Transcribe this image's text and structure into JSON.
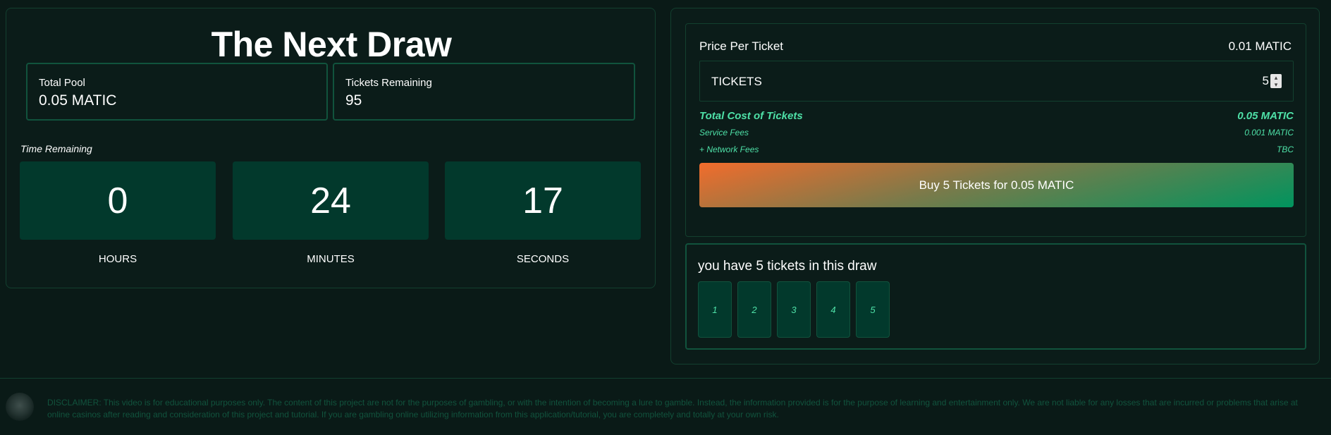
{
  "draw": {
    "title": "The Next Draw",
    "total_pool_label": "Total Pool",
    "total_pool_value": "0.05 MATIC",
    "tickets_remaining_label": "Tickets Remaining",
    "tickets_remaining_value": "95",
    "time_remaining_label": "Time Remaining",
    "hours_value": "0",
    "hours_label": "HOURS",
    "minutes_value": "24",
    "minutes_label": "MINUTES",
    "seconds_value": "17",
    "seconds_label": "SECONDS"
  },
  "purchase": {
    "price_label": "Price Per Ticket",
    "price_value": "0.01 MATIC",
    "tickets_label": "TICKETS",
    "tickets_value": "5",
    "total_cost_label": "Total Cost of Tickets",
    "total_cost_value": "0.05 MATIC",
    "service_fees_label": "Service Fees",
    "service_fees_value": "0.001 MATIC",
    "network_fees_label": "+ Network Fees",
    "network_fees_value": "TBC",
    "buy_button_label": "Buy 5 Tickets for 0.05 MATIC"
  },
  "my_tickets": {
    "title": "you have 5 tickets in this draw",
    "tickets": [
      "1",
      "2",
      "3",
      "4",
      "5"
    ]
  },
  "footer": {
    "disclaimer": "DISCLAIMER: This video is for educational purposes only. The content of this project are not for the purposes of gambling, or with the intention of becoming a lure to gamble. Instead, the information provided is for the purpose of learning and entertainment only. We are not liable for any losses that are incurred or problems that arise at online casinos after reading and consideration of this project and tutorial. If you are gambling online utilizing information from this application/tutorial, you are completely and totally at your own risk."
  },
  "colors": {
    "background": "#0a1a17",
    "accent_green": "#4ee0a7",
    "box_green": "#02392c",
    "button_gradient_start": "#f26c2c",
    "button_gradient_end": "#00945e"
  }
}
